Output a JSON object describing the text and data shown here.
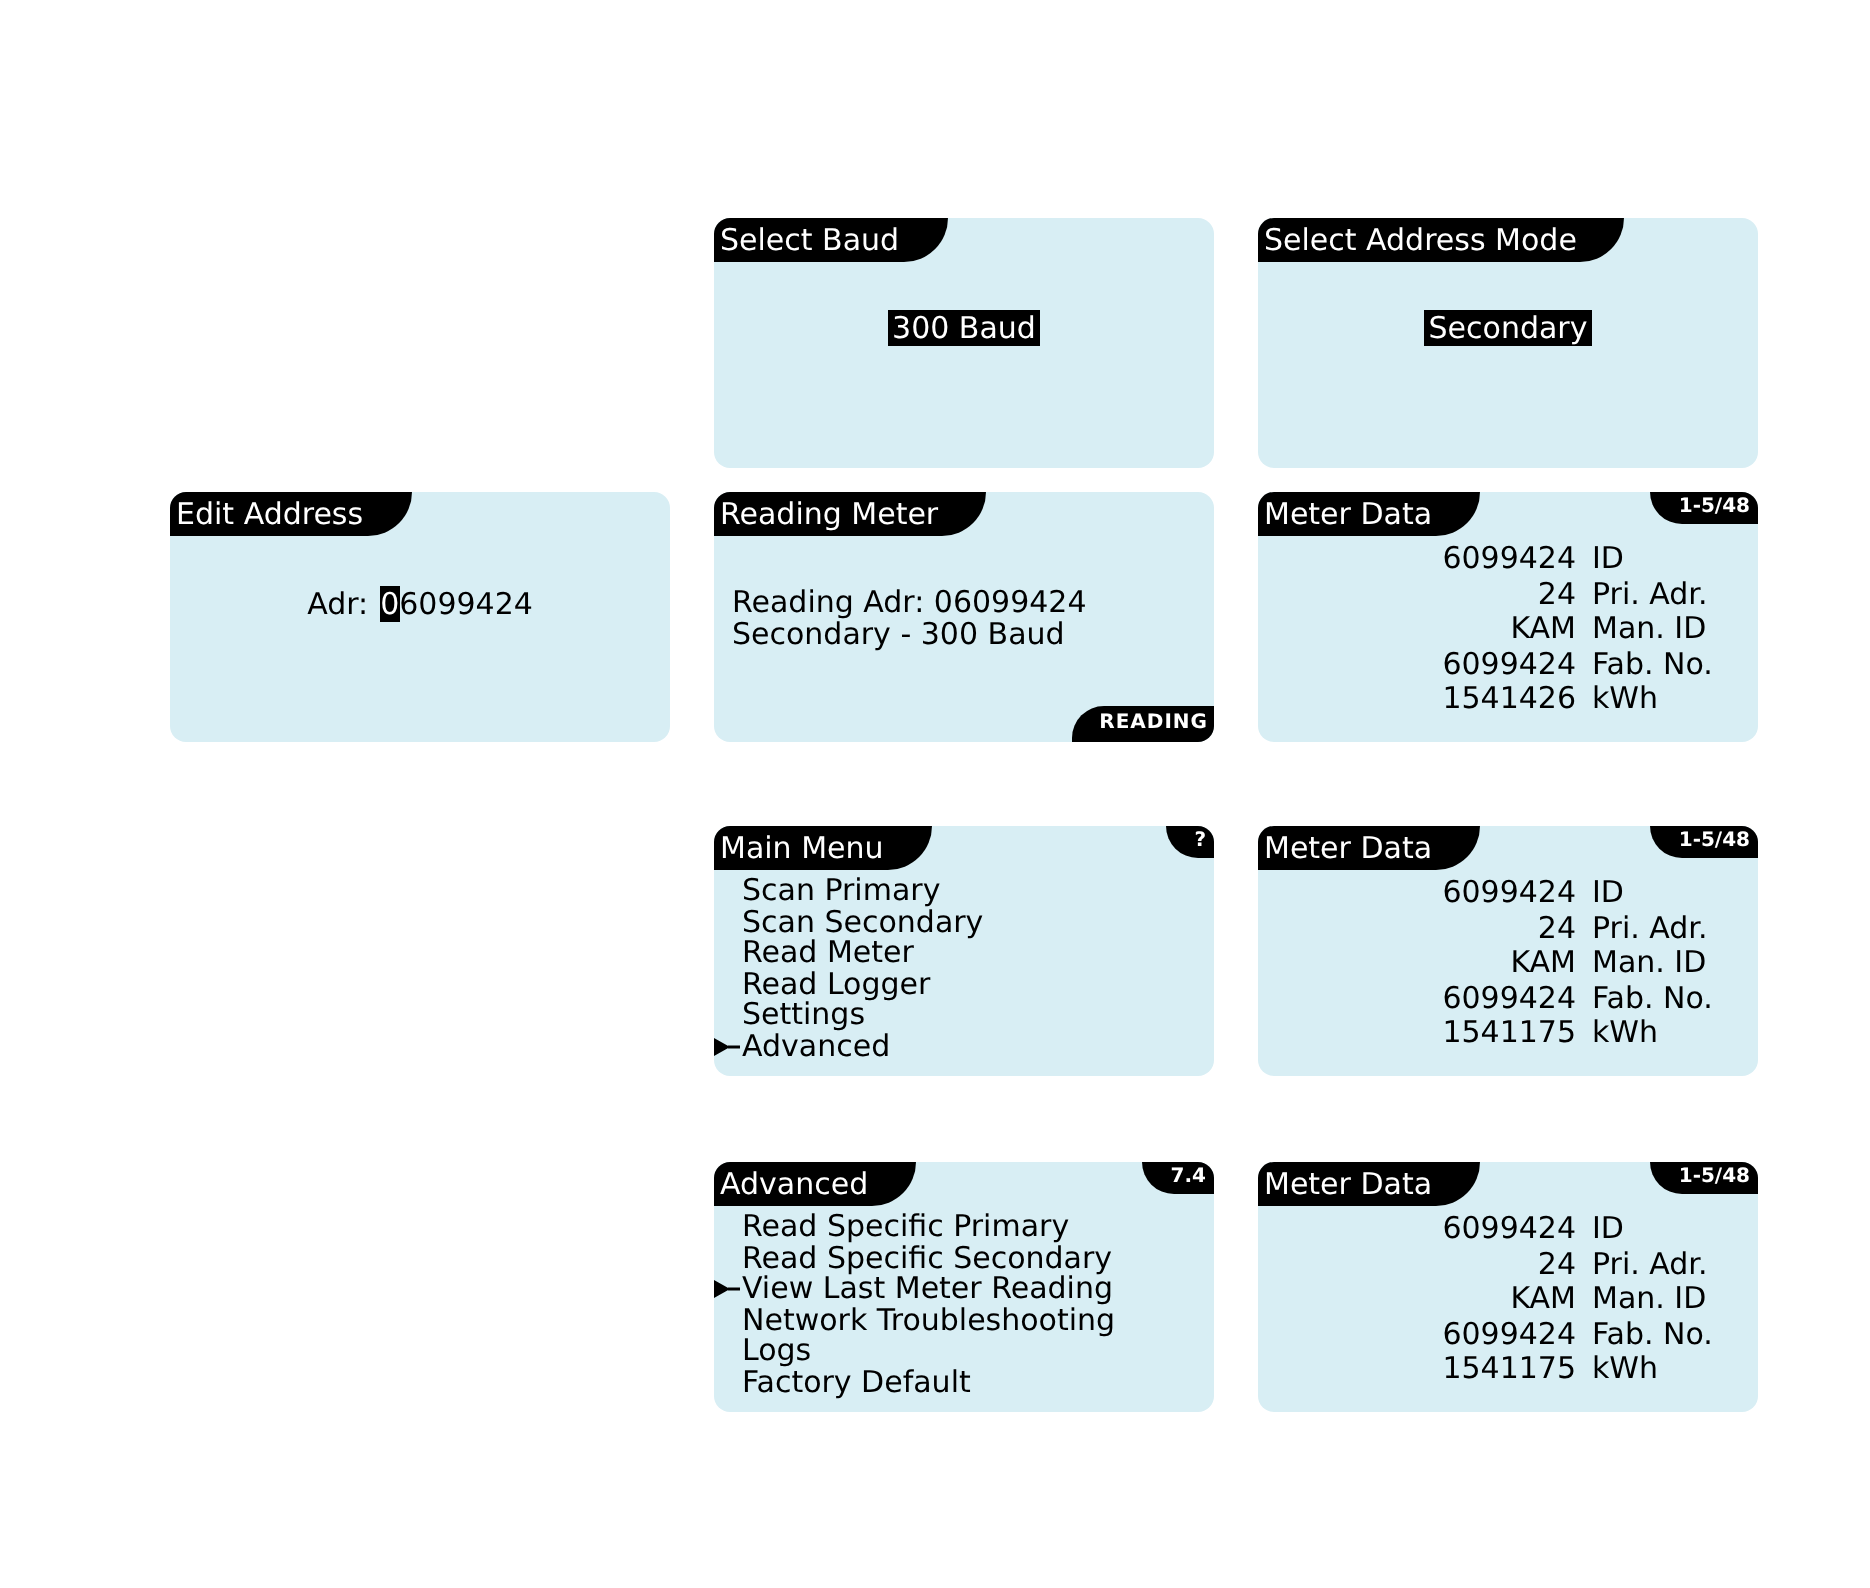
{
  "rows": [
    {
      "screens": [
        {
          "kind": "select",
          "title": "Select Baud",
          "option": {
            "text": "300 Baud",
            "selected": true
          }
        },
        {
          "kind": "select",
          "title": "Select Address Mode",
          "option": {
            "text": "Secondary",
            "selected": true
          }
        }
      ]
    },
    {
      "screens": [
        {
          "kind": "edit",
          "title": "Edit Address",
          "label": "Adr:",
          "value": [
            {
              "text": "0",
              "selected": true
            },
            {
              "text": "6099424",
              "selected": false
            }
          ]
        },
        {
          "kind": "status",
          "title": "Reading Meter",
          "lines": [
            "Reading Adr: 06099424",
            "Secondary - 300 Baud"
          ],
          "badge": "READING"
        },
        {
          "kind": "data",
          "title": "Meter Data",
          "page": "1-5/48",
          "readings": [
            {
              "reading": "6099424",
              "name": "ID"
            },
            {
              "reading": "24",
              "name": "Pri. Adr."
            },
            {
              "reading": "KAM",
              "name": "Man. ID"
            },
            {
              "reading": "6099424",
              "name": "Fab. No."
            },
            {
              "reading": "1541426",
              "name": "kWh"
            }
          ]
        }
      ]
    },
    {
      "screens": [
        {
          "kind": "menu",
          "title": "Main Menu",
          "page": "?",
          "items": [
            {
              "label": "Scan Primary",
              "selected": false
            },
            {
              "label": "Scan Secondary",
              "selected": false
            },
            {
              "label": "Read Meter",
              "selected": false
            },
            {
              "label": "Read Logger",
              "selected": false
            },
            {
              "label": "Settings",
              "selected": false
            },
            {
              "label": "Advanced",
              "selected": true
            }
          ]
        },
        {
          "kind": "data",
          "title": "Meter Data",
          "page": "1-5/48",
          "readings": [
            {
              "reading": "6099424",
              "name": "ID"
            },
            {
              "reading": "24",
              "name": "Pri. Adr."
            },
            {
              "reading": "KAM",
              "name": "Man. ID"
            },
            {
              "reading": "6099424",
              "name": "Fab. No."
            },
            {
              "reading": "1541175",
              "name": "kWh"
            }
          ]
        }
      ]
    },
    {
      "screens": [
        {
          "kind": "menu",
          "title": "Advanced",
          "page": "7.4",
          "items": [
            {
              "label": "Read Specific Primary",
              "selected": false
            },
            {
              "label": "Read Specific Secondary",
              "selected": false
            },
            {
              "label": "View Last Meter Reading",
              "selected": true
            },
            {
              "label": "Network Troubleshooting",
              "selected": false
            },
            {
              "label": "Logs",
              "selected": false
            },
            {
              "label": "Factory Default",
              "selected": false
            }
          ]
        },
        {
          "kind": "data",
          "title": "Meter Data",
          "page": "1-5/48",
          "readings": [
            {
              "reading": "6099424",
              "name": "ID"
            },
            {
              "reading": "24",
              "name": "Pri. Adr."
            },
            {
              "reading": "KAM",
              "name": "Man. ID"
            },
            {
              "reading": "6099424",
              "name": "Fab. No."
            },
            {
              "reading": "1541175",
              "name": "kWh"
            }
          ]
        }
      ]
    }
  ]
}
